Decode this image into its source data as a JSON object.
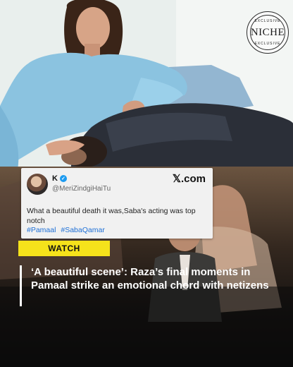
{
  "brand": {
    "logo_text": "NICHE",
    "logo_ring_top": "EXCLUSIVE",
    "logo_ring_bottom": "EXCLUSIVE"
  },
  "tweet": {
    "user_name": "K",
    "handle": "@MeriZindgiHaiTu",
    "source": "𝕏.com",
    "text": "What a beautiful death it was,Saba's acting was top notch",
    "hashtags": [
      "#Pamaal",
      "#SabaQamar"
    ]
  },
  "label": "WATCH",
  "headline": "‘A beautiful scene’: Raza’s final moments in Pamaal strike an emotional chord with netizens",
  "colors": {
    "accent_yellow": "#f5e21b",
    "hashtag_blue": "#1d6fd6",
    "verified_blue": "#1d9bf0"
  }
}
